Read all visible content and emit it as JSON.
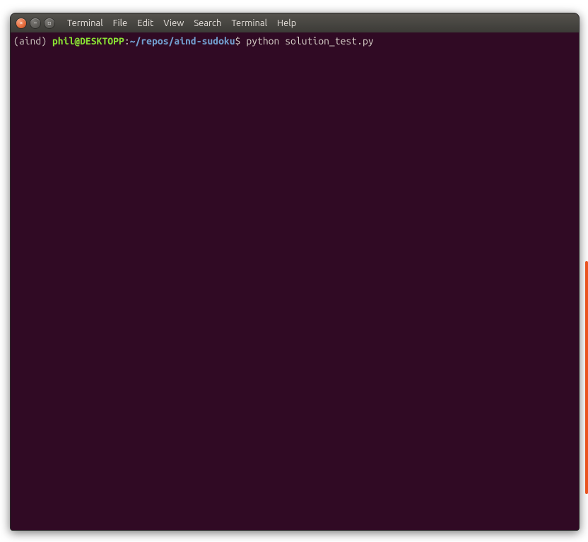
{
  "window": {
    "menus": [
      "Terminal",
      "File",
      "Edit",
      "View",
      "Search",
      "Terminal",
      "Help"
    ],
    "buttons": {
      "close_glyph": "×",
      "min_glyph": "–",
      "max_glyph": "▫"
    }
  },
  "prompt": {
    "env": "(aind) ",
    "user": "phil@DESKTOPP",
    "colon": ":",
    "path": "~/repos/aind-sudoku",
    "dollar": "$ ",
    "command": "python solution_test.py"
  }
}
